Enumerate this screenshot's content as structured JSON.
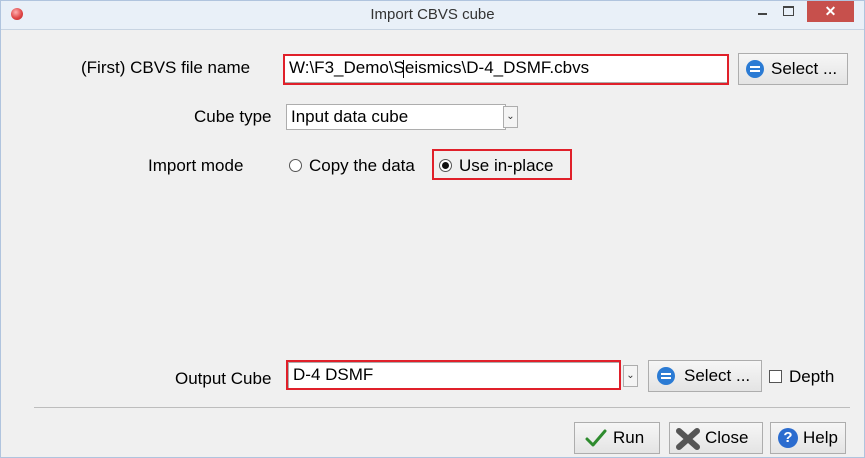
{
  "window": {
    "title": "Import CBVS cube",
    "minimize_glyph": "–",
    "maximize_glyph": "□",
    "close_glyph": "✕"
  },
  "file_row": {
    "label": "(First) CBVS file name",
    "value": "W:\\F3_Demo\\Seismics\\D-4_DSMF.cbvs",
    "select_label": "Select ..."
  },
  "cube_type": {
    "label": "Cube type",
    "selected": "Input data cube"
  },
  "import_mode": {
    "label": "Import mode",
    "options": [
      "Copy the data",
      "Use in-place"
    ],
    "selected": "Use in-place"
  },
  "output": {
    "label": "Output Cube",
    "value": "D-4 DSMF",
    "select_label": "Select ...",
    "depth_label": "Depth",
    "depth_checked": false
  },
  "footer": {
    "run_label": "Run",
    "close_label": "Close",
    "help_label": "Help"
  },
  "colors": {
    "highlight": "#e0202a",
    "close_button": "#c7504c",
    "select_icon": "#2b7bd4"
  },
  "icons": {
    "app": "app-icon",
    "select": "database-icon",
    "run": "checkmark-icon",
    "close": "close-x-icon",
    "help": "help-icon"
  }
}
